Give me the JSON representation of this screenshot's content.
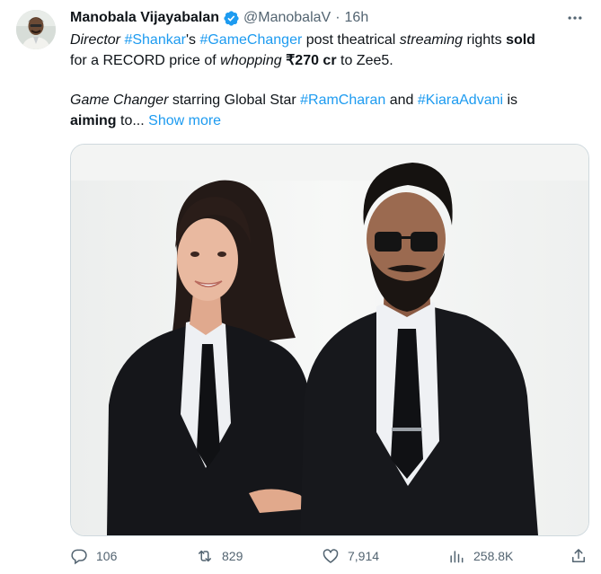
{
  "author": {
    "name": "Manobala Vijayabalan",
    "handle": "@ManobalaV",
    "separator": "·",
    "time": "16h",
    "verified_icon": "verified-badge-icon"
  },
  "tweet": {
    "line1_italic_a": "Director ",
    "line1_tag_a": "#Shankar",
    "line1_text_a": "'s ",
    "line1_tag_b": "#GameChanger",
    "line1_text_b": " post theatrical ",
    "line1_italic_b": "streaming",
    "line1_text_c": " rights ",
    "line1_bold_a": "sold",
    "line2_text_a": "for a RECORD price of ",
    "line2_italic_a": "whopping",
    "line2_text_b": " ",
    "line2_bold_a": "₹270 cr",
    "line2_text_c": " to Zee5.",
    "line3_italic_a": "Game Changer",
    "line3_text_a": " starring Global Star ",
    "line3_tag_a": "#RamCharan",
    "line3_text_b": " and ",
    "line3_tag_b": "#KiaraAdvani",
    "line3_text_c": " is",
    "line4_bold_a": "aiming",
    "line4_text_a": " to... ",
    "show_more": "Show more"
  },
  "actions": {
    "replies": "106",
    "retweets": "829",
    "likes": "7,914",
    "views": "258.8K"
  },
  "colors": {
    "accent": "#1d9bf0",
    "secondary_text": "#536471",
    "primary_text": "#0f1419"
  }
}
